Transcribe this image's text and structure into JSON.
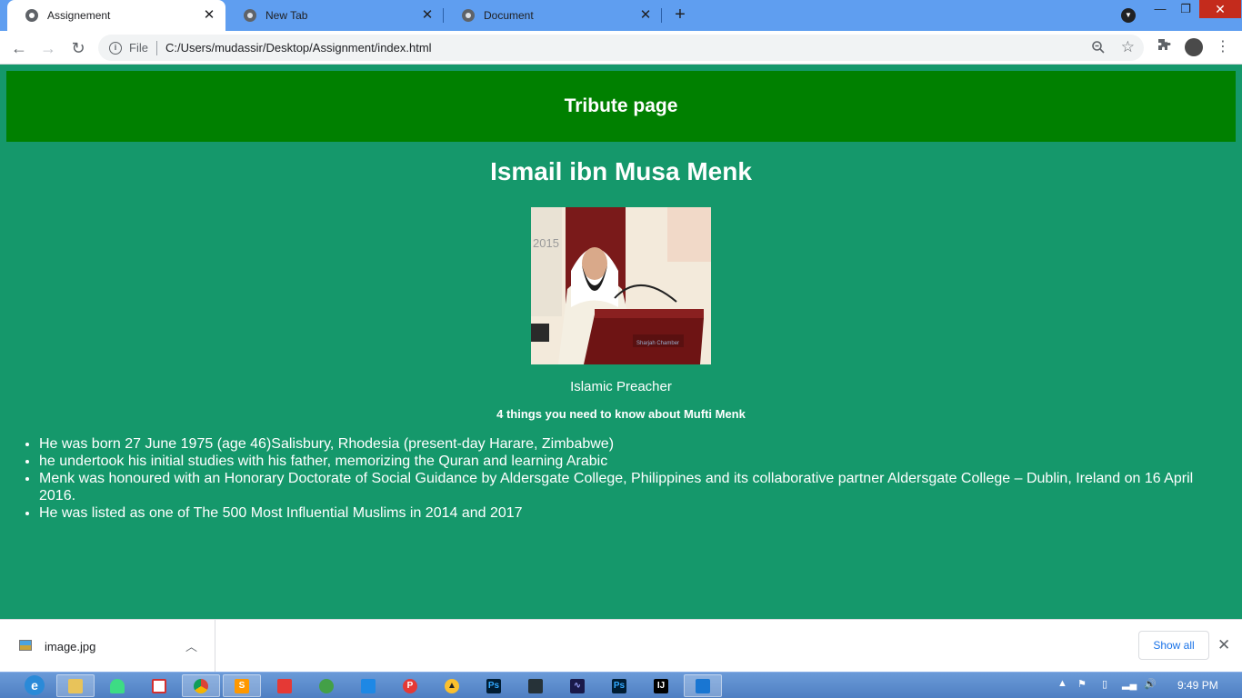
{
  "browser": {
    "tabs": [
      {
        "title": "Assignement",
        "active": true
      },
      {
        "title": "New Tab",
        "active": false
      },
      {
        "title": "Document",
        "active": false
      }
    ],
    "address": {
      "scheme": "File",
      "url": "C:/Users/mudassir/Desktop/Assignment/index.html"
    }
  },
  "page": {
    "header_title": "Tribute page",
    "main_title": "Ismail ibn Musa Menk",
    "image_caption": "Islamic Preacher",
    "subheading": "4 things you need to know about Mufti Menk",
    "facts": [
      "He was born 27 June 1975 (age 46)Salisbury, Rhodesia (present-day Harare, Zimbabwe)",
      "he undertook his initial studies with his father, memorizing the Quran and learning Arabic",
      "Menk was honoured with an Honorary Doctorate of Social Guidance by Aldersgate College, Philippines and its collaborative partner Aldersgate College – Dublin, Ireland on 16 April 2016.",
      "He was listed as one of The 500 Most Influential Muslims in 2014 and 2017"
    ],
    "colors": {
      "page_bg": "#15986b",
      "header_bg": "#008000",
      "text": "#ffffff"
    }
  },
  "downloads": {
    "file_name": "image.jpg",
    "show_all_label": "Show all"
  },
  "taskbar": {
    "clock": "9:49 PM"
  }
}
